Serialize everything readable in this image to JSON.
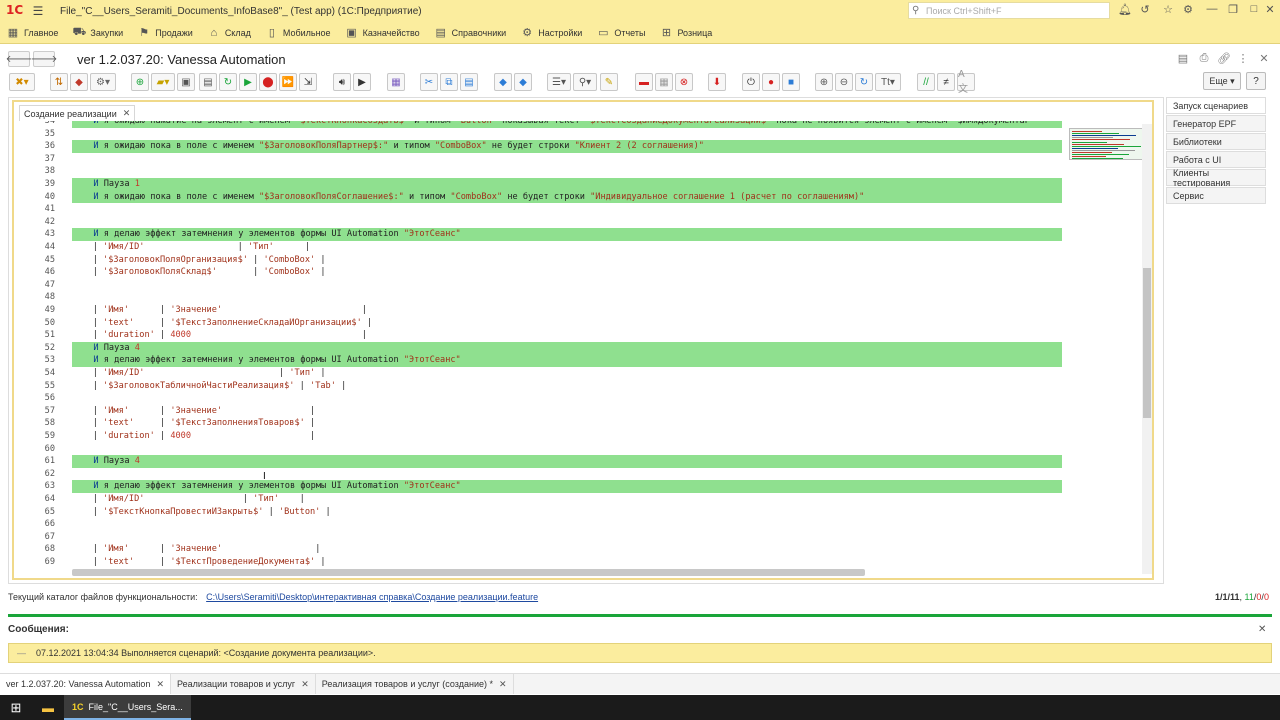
{
  "window": {
    "title": "File_\"C__Users_Seramiti_Documents_InfoBase8\"_ (Test app)  (1С:Предприятие)",
    "logo": "1С",
    "search_placeholder": "Поиск Ctrl+Shift+F"
  },
  "sections": [
    {
      "icon": "grid-icon",
      "label": "Главное"
    },
    {
      "icon": "cart-icon",
      "label": "Закупки"
    },
    {
      "icon": "sales-icon",
      "label": "Продажи"
    },
    {
      "icon": "warehouse-icon",
      "label": "Склад"
    },
    {
      "icon": "mobile-icon",
      "label": "Мобильное"
    },
    {
      "icon": "treasury-icon",
      "label": "Казначейство"
    },
    {
      "icon": "book-icon",
      "label": "Справочники"
    },
    {
      "icon": "gear-icon",
      "label": "Настройки"
    },
    {
      "icon": "report-icon",
      "label": "Отчеты"
    },
    {
      "icon": "retail-icon",
      "label": "Розница"
    }
  ],
  "header": {
    "title": "ver 1.2.037.20: Vanessa Automation",
    "more_label": "Еще",
    "help_label": "?"
  },
  "editor": {
    "tab_label": "Создание реализации",
    "lines": [
      {
        "n": "34",
        "text": "И я ожидаю нажатие на элемент с именем \"$ТекстКнопкаСоздать$\" и типом \"Button\" показывая текст \"$ТекстСозданиеДокументаРеализации$\" пока не появится элемент с именем \"$ИмяДокументаР",
        "hl": true
      },
      {
        "n": "35",
        "text": "",
        "hl": false
      },
      {
        "n": "36",
        "text": "И я ожидаю пока в поле с именем \"$ЗаголовокПоляПартнер$:\" и типом \"ComboBox\" не будет строки \"Клиент 2 (2 соглашения)\"",
        "hl": true
      },
      {
        "n": "37",
        "text": "",
        "hl": false
      },
      {
        "n": "38",
        "text": "",
        "hl": false
      },
      {
        "n": "39",
        "text": "И Пауза 1",
        "hl": true
      },
      {
        "n": "40",
        "text": "И я ожидаю пока в поле с именем \"$ЗаголовокПоляСоглашение$:\" и типом \"ComboBox\" не будет строки \"Индивидуальное соглашение 1 (расчет по соглашениям)\"",
        "hl": true
      },
      {
        "n": "41",
        "text": "",
        "hl": false
      },
      {
        "n": "42",
        "text": "",
        "hl": false
      },
      {
        "n": "43",
        "text": "И я делаю эффект затемнения у элементов формы UI Automation \"ЭтотСеанс\"",
        "hl": true
      },
      {
        "n": "44",
        "text": "    | 'Имя/ID'                  | 'Тип'      |",
        "hl": false
      },
      {
        "n": "45",
        "text": "    | '$ЗаголовокПоляОрганизация$' | 'ComboBox' |",
        "hl": false
      },
      {
        "n": "46",
        "text": "    | '$ЗаголовокПоляСклад$'       | 'ComboBox' |",
        "hl": false
      },
      {
        "n": "47",
        "text": "",
        "hl": false
      },
      {
        "n": "48",
        "text": "",
        "hl": false
      },
      {
        "n": "49",
        "text": "    | 'Имя'      | 'Значение'                           |",
        "hl": false
      },
      {
        "n": "50",
        "text": "    | 'text'     | '$ТекстЗаполнениеСкладаИОрганизации$' |",
        "hl": false
      },
      {
        "n": "51",
        "text": "    | 'duration' | 4000                                 |",
        "hl": false
      },
      {
        "n": "52",
        "text": "И Пауза 4",
        "hl": true
      },
      {
        "n": "53",
        "text": "И я делаю эффект затемнения у элементов формы UI Automation \"ЭтотСеанс\"",
        "hl": true
      },
      {
        "n": "54",
        "text": "    | 'Имя/ID'                          | 'Тип' |",
        "hl": false
      },
      {
        "n": "55",
        "text": "    | '$ЗаголовокТабличнойЧастиРеализация$' | 'Tab' |",
        "hl": false
      },
      {
        "n": "56",
        "text": "",
        "hl": false
      },
      {
        "n": "57",
        "text": "    | 'Имя'      | 'Значение'                 |",
        "hl": false
      },
      {
        "n": "58",
        "text": "    | 'text'     | '$ТекстЗаполненияТоваров$' |",
        "hl": false
      },
      {
        "n": "59",
        "text": "    | 'duration' | 4000                       |",
        "hl": false
      },
      {
        "n": "60",
        "text": "",
        "hl": false
      },
      {
        "n": "61",
        "text": "И Пауза 4",
        "hl": true
      },
      {
        "n": "62",
        "text": "",
        "hl": false
      },
      {
        "n": "63",
        "text": "И я делаю эффект затемнения у элементов формы UI Automation \"ЭтотСеанс\"",
        "hl": true
      },
      {
        "n": "64",
        "text": "    | 'Имя/ID'                   | 'Тип'    |",
        "hl": false
      },
      {
        "n": "65",
        "text": "    | '$ТекстКнопкаПровестиИЗакрыть$' | 'Button' |",
        "hl": false
      },
      {
        "n": "66",
        "text": "",
        "hl": false
      },
      {
        "n": "67",
        "text": "",
        "hl": false
      },
      {
        "n": "68",
        "text": "    | 'Имя'      | 'Значение'                  |",
        "hl": false
      },
      {
        "n": "69",
        "text": "    | 'text'     | '$ТекстПроведениеДокумента$' |",
        "hl": false
      }
    ]
  },
  "sidebar": {
    "items": [
      {
        "label": "Запуск сценариев",
        "active": true
      },
      {
        "label": "Генератор EPF",
        "active": false
      },
      {
        "label": "Библиотеки",
        "active": false
      },
      {
        "label": "Работа с UI",
        "active": false
      },
      {
        "label": "Клиенты тестирования",
        "active": false
      },
      {
        "label": "Сервис",
        "active": false
      }
    ]
  },
  "footer": {
    "catalog_label": "Текущий каталог файлов функциональности:",
    "catalog_path": "C:\\Users\\Seramiti\\Desktop\\интерактивная справка\\Создание реализации.feature",
    "counter_total": "1/1/11",
    "counter_passed": "11",
    "counter_failed": "0",
    "counter_skipped": "0"
  },
  "messages": {
    "title": "Сообщения:",
    "items": [
      {
        "text": "07.12.2021 13:04:34 Выполняется сценарий: <Создание документа реализации>."
      }
    ]
  },
  "window_tabs": [
    {
      "label": "ver 1.2.037.20: Vanessa Automation",
      "active": true
    },
    {
      "label": "Реализации товаров и услуг",
      "active": false
    },
    {
      "label": "Реализация товаров и услуг (создание) *",
      "active": false
    }
  ],
  "taskbar": {
    "app_label": "File_\"C__Users_Sera...",
    "app_logo": "1С"
  },
  "colors": {
    "accent_yellow": "#fbed9e",
    "highlight_green": "#8fe08f",
    "status_green": "#1aa53a"
  }
}
